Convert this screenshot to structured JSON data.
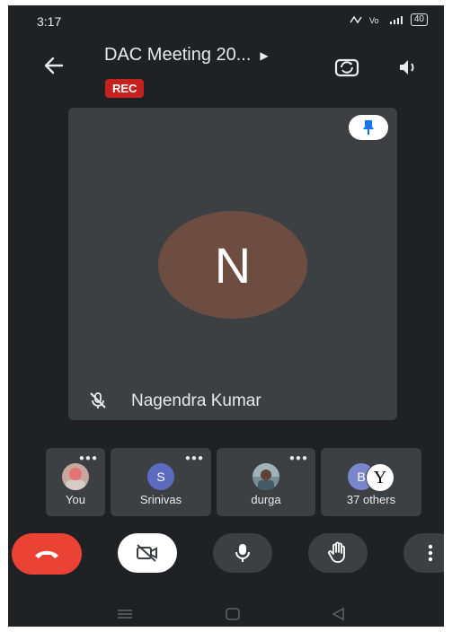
{
  "status": {
    "time": "3:17",
    "icons": "⋯✧ Vo ⁴ᴳ ▌",
    "battery": "40"
  },
  "header": {
    "title": "DAC Meeting 20...",
    "rec_label": "REC"
  },
  "main_tile": {
    "initial": "N",
    "name": "Nagendra Kumar",
    "avatar_color": "#6d4c41",
    "mic_state": "muted"
  },
  "participants": [
    {
      "label": "You",
      "avatar": "",
      "color": "#c7a8a0"
    },
    {
      "label": "Srinivas",
      "avatar": "S",
      "color": "#5c6bc0"
    },
    {
      "label": "durga",
      "avatar": "",
      "color": "#7a8f95"
    },
    {
      "label": "37 others",
      "avatar": "B",
      "avatar2": "Y",
      "color": "#7986cb"
    }
  ],
  "controls": {
    "end_call_color": "#ea4335",
    "camera_state": "off",
    "buttons": [
      "end-call-icon",
      "camera-off-icon",
      "microphone-icon",
      "raise-hand-icon",
      "more-options-icon"
    ]
  },
  "colors": {
    "background": "#202124",
    "tile": "#3c4043",
    "rec": "#c5221f"
  }
}
